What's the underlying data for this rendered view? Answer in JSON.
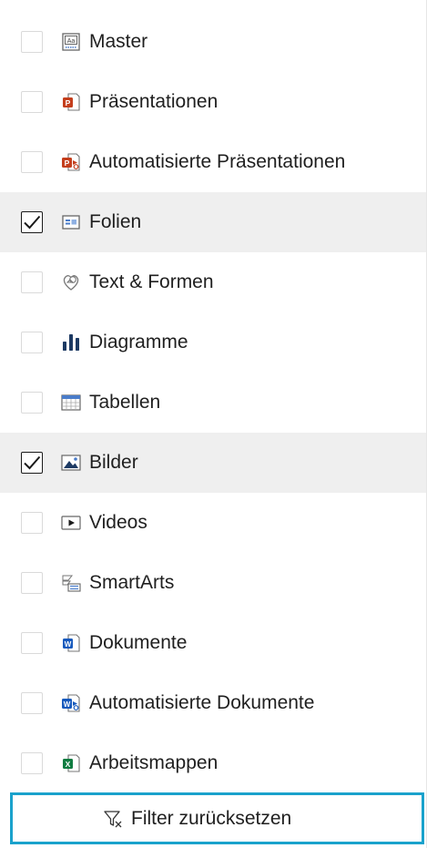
{
  "filters": [
    {
      "label": "Master",
      "checked": false,
      "icon": "master-slide-icon"
    },
    {
      "label": "Präsentationen",
      "checked": false,
      "icon": "powerpoint-file-icon"
    },
    {
      "label": "Automatisierte Präsentationen",
      "checked": false,
      "icon": "automated-powerpoint-icon"
    },
    {
      "label": "Folien",
      "checked": true,
      "icon": "slide-icon"
    },
    {
      "label": "Text & Formen",
      "checked": false,
      "icon": "shapes-icon"
    },
    {
      "label": "Diagramme",
      "checked": false,
      "icon": "bar-chart-icon"
    },
    {
      "label": "Tabellen",
      "checked": false,
      "icon": "table-icon"
    },
    {
      "label": "Bilder",
      "checked": true,
      "icon": "image-icon"
    },
    {
      "label": "Videos",
      "checked": false,
      "icon": "video-icon"
    },
    {
      "label": "SmartArts",
      "checked": false,
      "icon": "smartart-icon"
    },
    {
      "label": "Dokumente",
      "checked": false,
      "icon": "word-file-icon"
    },
    {
      "label": "Automatisierte Dokumente",
      "checked": false,
      "icon": "automated-word-icon"
    },
    {
      "label": "Arbeitsmappen",
      "checked": false,
      "icon": "excel-file-icon"
    }
  ],
  "reset": {
    "label": "Filter zurücksetzen",
    "icon": "filter-clear-icon"
  },
  "colors": {
    "accent_border": "#1aa2cc",
    "checked_row_bg": "#efefef",
    "powerpoint": "#c43e1c",
    "word": "#185abd",
    "excel": "#107c41"
  }
}
